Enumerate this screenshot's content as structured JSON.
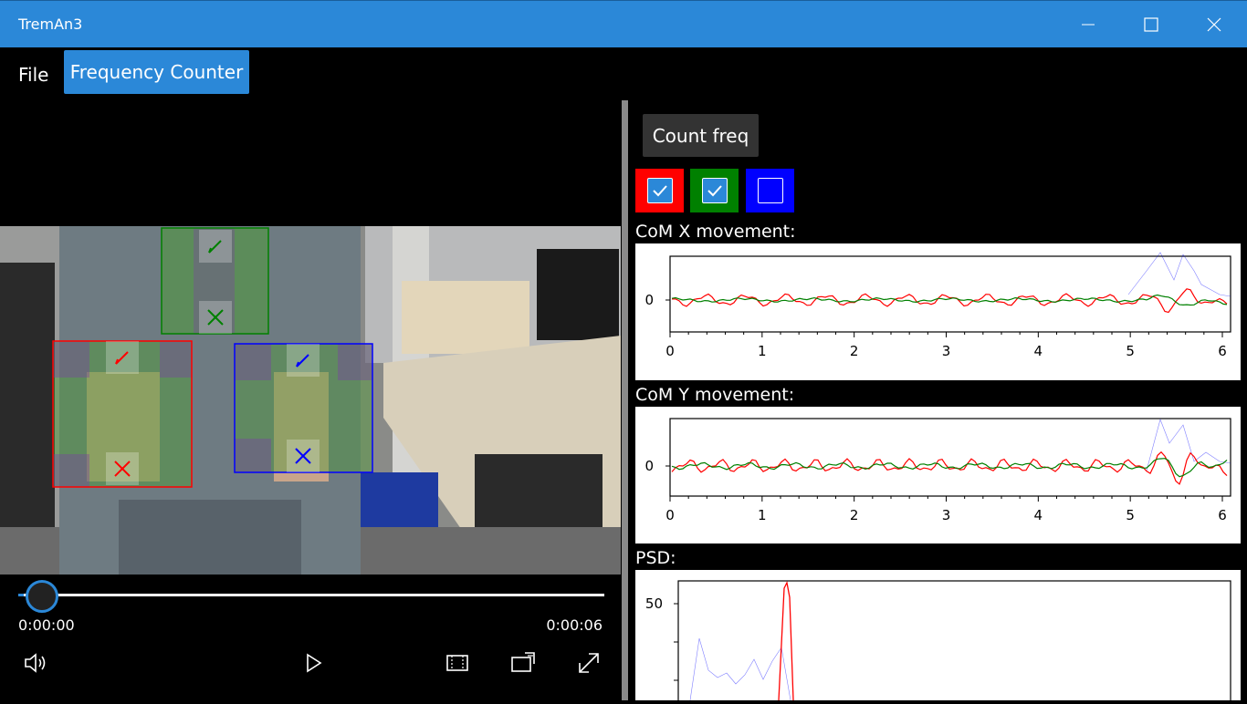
{
  "window": {
    "title": "TremAn3"
  },
  "menu": {
    "file": "File",
    "frequency_counter": "Frequency Counter"
  },
  "player": {
    "current_time": "0:00:00",
    "total_time": "0:00:06",
    "progress": 0.0
  },
  "toolbar": {
    "count_freq": "Count freq"
  },
  "roi_colors": [
    {
      "color": "#ff0000",
      "checked": true
    },
    {
      "color": "#008000",
      "checked": true
    },
    {
      "color": "#0000ff",
      "checked": false
    }
  ],
  "charts": {
    "com_x": {
      "label": "CoM X movement:",
      "x_ticks": [
        "0",
        "1",
        "2",
        "3",
        "4",
        "5",
        "6"
      ],
      "y_ticks": [
        "0"
      ]
    },
    "com_y": {
      "label": "CoM Y movement:",
      "x_ticks": [
        "0",
        "1",
        "2",
        "3",
        "4",
        "5",
        "6"
      ],
      "y_ticks": [
        "0"
      ]
    },
    "psd": {
      "label": "PSD:",
      "y_ticks": [
        "50"
      ]
    }
  },
  "icons": {
    "minimize": "minimize-icon",
    "maximize": "maximize-icon",
    "close": "close-icon",
    "volume": "volume-icon",
    "play": "play-icon",
    "crop": "aspect-icon",
    "cast": "cast-icon",
    "fullscreen": "fullscreen-icon",
    "edit": "pencil-icon",
    "remove": "x-icon"
  }
}
